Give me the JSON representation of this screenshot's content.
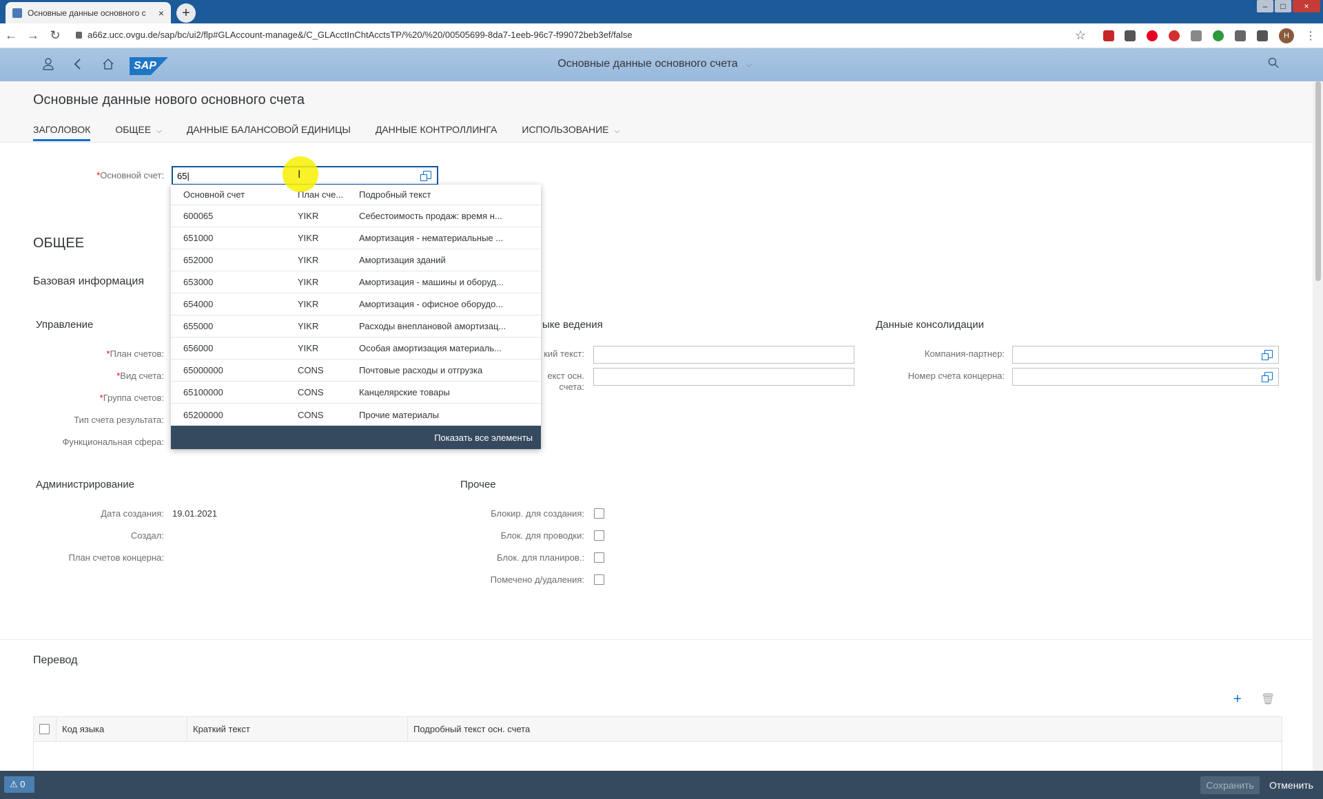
{
  "browser": {
    "tab_title": "Основные данные основного с",
    "tab_close": "×",
    "new_tab": "+",
    "url": "a66z.ucc.ovgu.de/sap/bc/ui2/flp#GLAccount-manage&/C_GLAcctInChtAcctsTP/%20/%20/00505699-8da7-1eeb-96c7-f99072beb3ef/false",
    "profile_initial": "H",
    "nav_back": "←",
    "nav_forward": "→",
    "reload": "↻",
    "bookmark": "☆",
    "menu": "⋮"
  },
  "shell": {
    "title": "Основные данные основного счета",
    "logo": "SAP",
    "title_caret": "⌵"
  },
  "header": {
    "title": "Основные данные нового основного счета",
    "anchors": [
      "ЗАГОЛОВОК",
      "ОБЩЕЕ",
      "ДАННЫЕ БАЛАНСОВОЙ ЕДИНИЦЫ",
      "ДАННЫЕ КОНТРОЛЛИНГА",
      "ИСПОЛЬЗОВАНИЕ"
    ]
  },
  "account_field": {
    "label": "Основной счет:",
    "value": "65",
    "required_mark": "*"
  },
  "suggestions": {
    "columns": [
      "Основной счет",
      "План сче...",
      "Подробный текст"
    ],
    "rows": [
      [
        "600065",
        "YIKR",
        "Себестоимость продаж: время н..."
      ],
      [
        "651000",
        "YIKR",
        "Амортизация - нематериальные ..."
      ],
      [
        "652000",
        "YIKR",
        "Амортизация зданий"
      ],
      [
        "653000",
        "YIKR",
        "Амортизация - машины и оборуд..."
      ],
      [
        "654000",
        "YIKR",
        "Амортизация - офисное оборудо..."
      ],
      [
        "655000",
        "YIKR",
        "Расходы внеплановой амортизац..."
      ],
      [
        "656000",
        "YIKR",
        "Особая амортизация материаль..."
      ],
      [
        "65000000",
        "CONS",
        "Почтовые расходы и отгрузка"
      ],
      [
        "65100000",
        "CONS",
        "Канцелярские товары"
      ],
      [
        "65200000",
        "CONS",
        "Прочие материалы"
      ]
    ],
    "show_all": "Показать все элементы"
  },
  "general": {
    "section_title": "ОБЩЕЕ",
    "subsection_title": "Базовая информация",
    "control": {
      "title": "Управление",
      "fields": [
        "План счетов:",
        "Вид счета:",
        "Группа счетов:",
        "Тип счета результата:",
        "Функциональная сфера:"
      ]
    },
    "language": {
      "title_partial": "ыке ведения",
      "short_text_label_partial": "кий текст:",
      "long_text_label_partial_1": "екст осн.",
      "long_text_label_partial_2": "счета:"
    },
    "consolidation": {
      "title": "Данные консолидации",
      "partner_label": "Компания-партнер:",
      "group_account_label": "Номер счета концерна:"
    },
    "admin": {
      "title": "Администрирование",
      "created_on_label": "Дата создания:",
      "created_on_value": "19.01.2021",
      "created_by_label": "Создал:",
      "group_coa_label": "План счетов концерна:"
    },
    "other": {
      "title": "Прочее",
      "flags": [
        "Блокир. для создания:",
        "Блок. для проводки:",
        "Блок. для планиров.:",
        "Помечено д/удаления:"
      ]
    }
  },
  "translation": {
    "title": "Перевод",
    "add_icon": "+",
    "delete_icon": "🗑",
    "columns": [
      "Код языка",
      "Краткий текст",
      "Подробный текст осн. счета"
    ]
  },
  "footer": {
    "messages_count": "0",
    "save": "Сохранить",
    "cancel": "Отменить"
  }
}
